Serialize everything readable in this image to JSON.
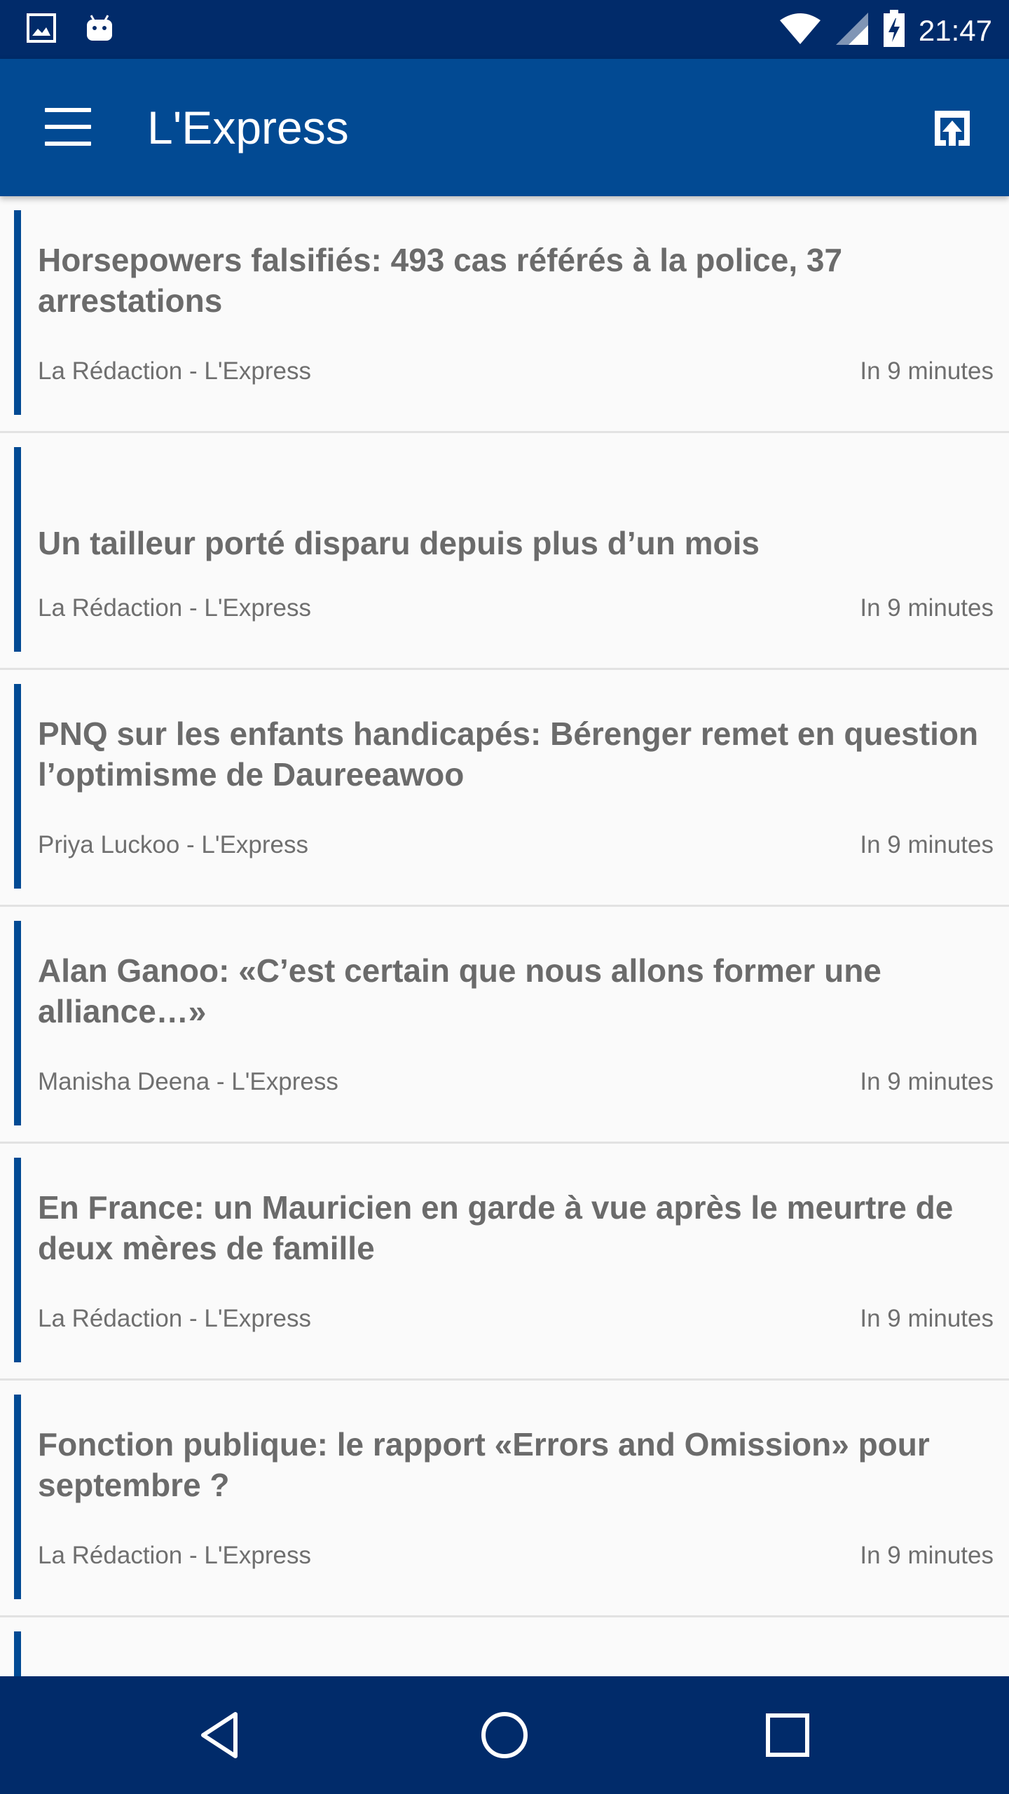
{
  "status_bar": {
    "time": "21:47",
    "icons": [
      "image-icon",
      "android-icon",
      "wifi-icon",
      "signal-icon",
      "battery-charging-icon"
    ]
  },
  "app_bar": {
    "title": "L'Express",
    "menu_icon": "hamburger-menu-icon",
    "action_icon": "open-in-browser-icon"
  },
  "articles": [
    {
      "title": "Horsepowers falsifiés: 493 cas référés à la police, 37 arrestations",
      "author": "La Rédaction - L'Express",
      "time": "In 9 minutes"
    },
    {
      "title": "Un tailleur porté disparu depuis plus d’un mois",
      "author": "La Rédaction - L'Express",
      "time": "In 9 minutes"
    },
    {
      "title": "PNQ sur les enfants handicapés: Bérenger remet en question l’optimisme de Daureeawoo",
      "author": "Priya Luckoo - L'Express",
      "time": "In 9 minutes"
    },
    {
      "title": "Alan Ganoo: «C’est certain que nous allons former une alliance…»",
      "author": "Manisha Deena - L'Express",
      "time": "In 9 minutes"
    },
    {
      "title": "En France: un Mauricien en garde à vue après le meurtre de deux mères de famille",
      "author": "La Rédaction - L'Express",
      "time": "In 9 minutes"
    },
    {
      "title": "Fonction publique: le rapport «Errors and Omission» pour septembre ?",
      "author": "La Rédaction - L'Express",
      "time": "In 9 minutes"
    }
  ],
  "nav_bar": {
    "icons": [
      "back-icon",
      "home-icon",
      "recents-icon"
    ]
  },
  "colors": {
    "status_bar": "#012b6a",
    "app_bar": "#024a93",
    "accent": "#024a93",
    "background": "#fafafa"
  }
}
